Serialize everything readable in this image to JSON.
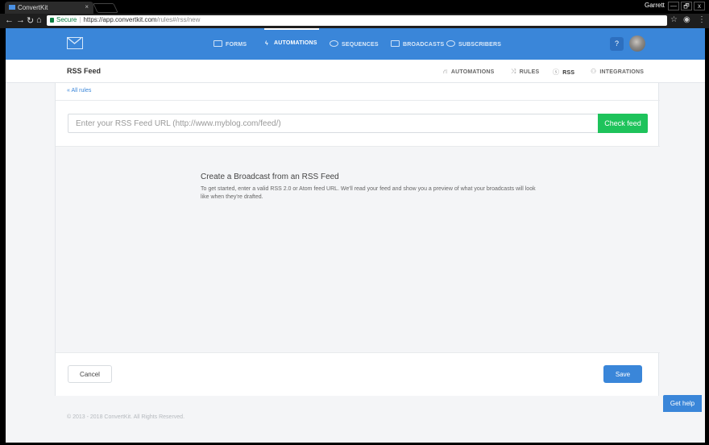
{
  "browser": {
    "tab_title": "ConvertKit",
    "tab_close": "×",
    "profile": "Garrett",
    "secure_label": "Secure",
    "url_host": "https://app.convertkit.com",
    "url_path": "/rules#/rss/new",
    "win_min": "—",
    "win_restore": "🗗",
    "win_close": "x"
  },
  "topnav": {
    "items": [
      {
        "label": "FORMS"
      },
      {
        "label": "AUTOMATIONS",
        "active": true
      },
      {
        "label": "SEQUENCES"
      },
      {
        "label": "BROADCASTS"
      },
      {
        "label": "SUBSCRIBERS"
      }
    ],
    "help_label": "?"
  },
  "subnav": {
    "title": "RSS Feed",
    "items": [
      {
        "label": "AUTOMATIONS"
      },
      {
        "label": "RULES"
      },
      {
        "label": "RSS",
        "active": true
      },
      {
        "label": "INTEGRATIONS"
      }
    ]
  },
  "form": {
    "back_link": "« All rules",
    "url_placeholder": "Enter your RSS Feed URL (http://www.myblog.com/feed/)",
    "check_button": "Check feed",
    "preview_title": "Create a Broadcast from an RSS Feed",
    "preview_desc": "To get started, enter a valid RSS 2.0 or Atom feed URL. We'll read your feed and show you a preview of what your broadcasts will look like when they're drafted.",
    "cancel_button": "Cancel",
    "save_button": "Save"
  },
  "footer": {
    "copyright": "© 2013 - 2018 ConvertKit. All Rights Reserved.",
    "get_help": "Get help"
  },
  "colors": {
    "brand_blue": "#3a86d9",
    "check_green": "#1ec35b"
  }
}
